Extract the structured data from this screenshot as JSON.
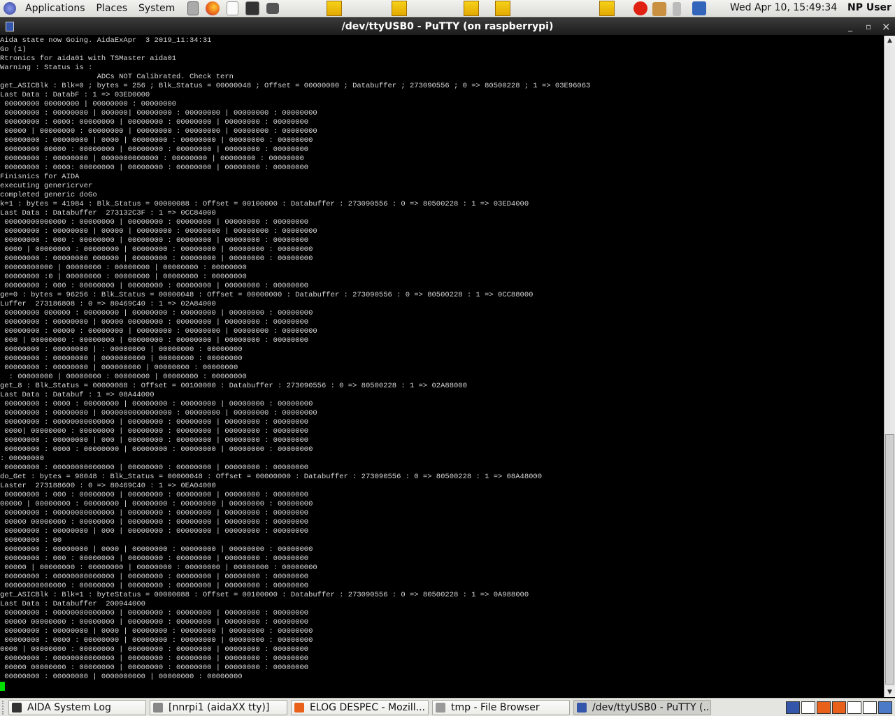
{
  "topbar": {
    "menus": [
      "Applications",
      "Places",
      "System"
    ],
    "clock": "Wed Apr 10, 15:49:34",
    "user": "NP User"
  },
  "window": {
    "title": "/dev/ttyUSB0 - PuTTY (on raspberrypi)",
    "minimize": "_",
    "maximize": "▫",
    "close": "×"
  },
  "terminal": {
    "lines": [
      "Aida state now Going. AidaExApr  3 2019_11:34:31",
      "Go (1)",
      "Rtronics for aida01 with TSMaster aida01",
      "Warning : Status is :",
      "                      ADCs NOT Calibrated. Check tern",
      "get_ASICBlk : Blk=0 ; bytes = 256 ; Blk_Status = 00000048 ; Offset = 00000000 ; Databuffer ; 273090556 ; 0 => 80500228 ; 1 => 03E96063",
      "Last Data : DatabF : 1 => 03ED0000",
      " 00000000 00000000 | 00000000 : 00000000",
      " 00000000 : 00000000 | 000000| 00000000 : 00000000 | 00000000 : 00000000",
      " 00000000 : 0000: 00000000 | 00000000 : 00000000 | 00000000 : 00000000",
      " 00000 | 00000000 : 00000000 | 00000000 : 00000000 | 00000000 : 00000000",
      " 00000000 : 00000000 | 0000 | 00000000 : 00000000 | 00000000 : 00000000",
      " 00000000 00000 : 00000000 | 00000000 : 00000000 | 00000000 : 00000000",
      " 00000000 : 00000000 | 0000000000000 : 00000000 | 00000000 : 00000000",
      " 00000000 : 0000: 00000000 | 00000000 : 00000000 | 00000000 : 00000000",
      "Finisnics for AIDA",
      "executing genericrver",
      "completed generic doGo",
      "k=1 : bytes = 41984 : Blk_Status = 00000088 : Offset = 00100000 : Databuffer : 273090556 : 0 => 80500228 : 1 => 03ED4000",
      "Last Data : Databuffer  273132C3F : 1 => 0CC84000",
      " 00000000000000 : 00000000 | 00000000 : 00000000 | 00000000 : 00000000",
      " 00000000 : 00000000 | 00000 | 00000000 : 00000000 | 00000000 : 00000000",
      " 00000000 : 000 : 00000000 | 00000000 : 00000000 | 00000000 : 00000000",
      " 0000 | 00000000 : 00000000 | 00000000 : 00000000 | 00000000 : 00000000",
      " 00000000 : 00000000 000000 | 00000000 : 00000000 | 00000000 : 00000000",
      " 00000000000 | 00000000 : 00000000 | 00000000 : 00000000",
      " 00000000 :0 | 00000000 : 00000000 | 00000000 : 00000000",
      " 00000000 : 000 : 00000000 | 00000000 : 00000000 | 00000000 : 00000000",
      "ge=0 : bytes = 96256 : Blk_Status = 00000048 : Offset = 00000000 : Databuffer : 273090556 : 0 => 80500228 : 1 => 0CC88000",
      "Luffer  273186808 : 0 => 80469C40 : 1 => 02A84000",
      " 00000000 000000 : 00000000 | 00000000 : 00000000 | 00000000 : 00000000",
      " 00000000 : 00000000 | 00000 00000000 : 00000000 | 00000000 : 00000000",
      " 00000000 : 00000 : 00000000 | 00000000 : 00000000 | 00000000 : 00000000",
      " 000 | 00000000 : 00000000 | 00000000 : 00000000 | 00000000 : 00000000",
      " 00000000 : 00000000 | : 00000000 | 00000000 : 00000000",
      " 00000000 : 00000000 | 0000000000 | 00000000 : 00000000",
      " 00000000 : 00000000 | 000000000 | 00000000 : 00000000",
      "  : 00000000 | 00000000 : 00000000 | 00000000 : 00000000",
      "get_8 : Blk_Status = 00000088 : Offset = 00100000 : Databuffer : 273090556 : 0 => 80500228 : 1 => 02A88000",
      "Last Data : Databuf : 1 => 08A44000",
      " 00000000 : 0000 : 00000000 | 00000000 : 00000000 | 00000000 : 00000000",
      " 00000000 : 00000000 | 0000000000000000 : 00000000 | 00000000 : 00000000",
      " 00000000 : 00000000000000 | 00000000 : 00000000 | 00000000 : 00000000",
      " 0000| 00000000 : 00000000 | 00000000 : 00000000 | 00000000 : 00000000",
      " 00000000 : 00000000 | 000 | 00000000 : 00000000 | 00000000 : 00000000",
      " 00000000 : 0000 : 00000000 | 00000000 : 00000000 | 00000000 : 00000000",
      ": 00000000",
      " 00000000 : 00000000000000 | 00000000 : 00000000 | 00000000 : 00000000",
      "do_Get : bytes = 98048 : Blk_Status = 00000048 : Offset = 00000000 : Databuffer : 273090556 : 0 => 80500228 : 1 => 08A48000",
      "Laster  273188600 : 0 => 80469C40 : 1 => 0EA04000",
      " 00000000 : 000 : 00000000 | 00000000 : 00000000 | 00000000 : 00000000",
      "00000 | 00000000 : 00000000 | 00000000 : 00000000 | 00000000 : 00000000",
      " 00000000 : 00000000000000 | 00000000 : 00000000 | 00000000 : 00000000",
      " 00000 00000000 : 00000000 | 00000000 : 00000000 | 00000000 : 00000000",
      " 00000000 : 00000000 | 000 | 00000000 : 00000000 | 00000000 : 00000000",
      " 00000000 : 00",
      " 00000000 : 00000000 | 0000 | 00000000 : 00000000 | 00000000 : 00000000",
      " 00000000 : 000 : 00000000 | 00000000 : 00000000 | 00000000 : 00000000",
      " 00000 | 00000000 : 00000000 | 00000000 : 00000000 | 00000000 : 00000000",
      " 00000000 : 00000000000000 | 00000000 : 00000000 | 00000000 : 00000000",
      " 00000000000000 : 00000000 | 00000000 : 00000000 | 00000000 : 00000000",
      "get_ASICBlk : Blk=1 : byteStatus = 00000088 : Offset = 00100000 : Databuffer : 273090556 : 0 => 80500228 : 1 => 0A988000",
      "Last Data : Databuffer  200944000",
      " 00000000 : 00000000000000 | 00000000 : 00000000 | 00000000 : 00000000",
      " 00000 00000000 : 00000000 | 00000000 : 00000000 | 00000000 : 00000000",
      " 00000000 : 00000000 | 0000 | 00000000 : 00000000 | 00000000 : 00000000",
      " 00000000 : 0000 : 00000000 | 00000000 : 00000000 | 00000000 : 00000000",
      "0000 | 00000000 : 00000000 | 00000000 : 00000000 | 00000000 : 00000000",
      " 00000000 : 00000000000000 | 00000000 : 00000000 | 00000000 : 00000000",
      " 00000 00000000 : 00000000 | 00000000 : 00000000 | 00000000 : 00000000",
      " 00000000 : 00000000 | 0000000000 | 00000000 : 00000000"
    ]
  },
  "taskbar": {
    "tasks": [
      {
        "label": "AIDA System Log",
        "icon": "terminal-icon",
        "color": "#333333"
      },
      {
        "label": "[nnrpi1 (aidaXX tty)]",
        "icon": "terminal-icon",
        "color": "#888888"
      },
      {
        "label": "ELOG DESPEC - Mozill...",
        "icon": "firefox-icon",
        "color": "#e8601a"
      },
      {
        "label": "tmp - File Browser",
        "icon": "file-browser-icon",
        "color": "#999999"
      },
      {
        "label": "/dev/ttyUSB0 - PuTTY (...",
        "icon": "putty-icon",
        "color": "#3355aa"
      }
    ]
  }
}
